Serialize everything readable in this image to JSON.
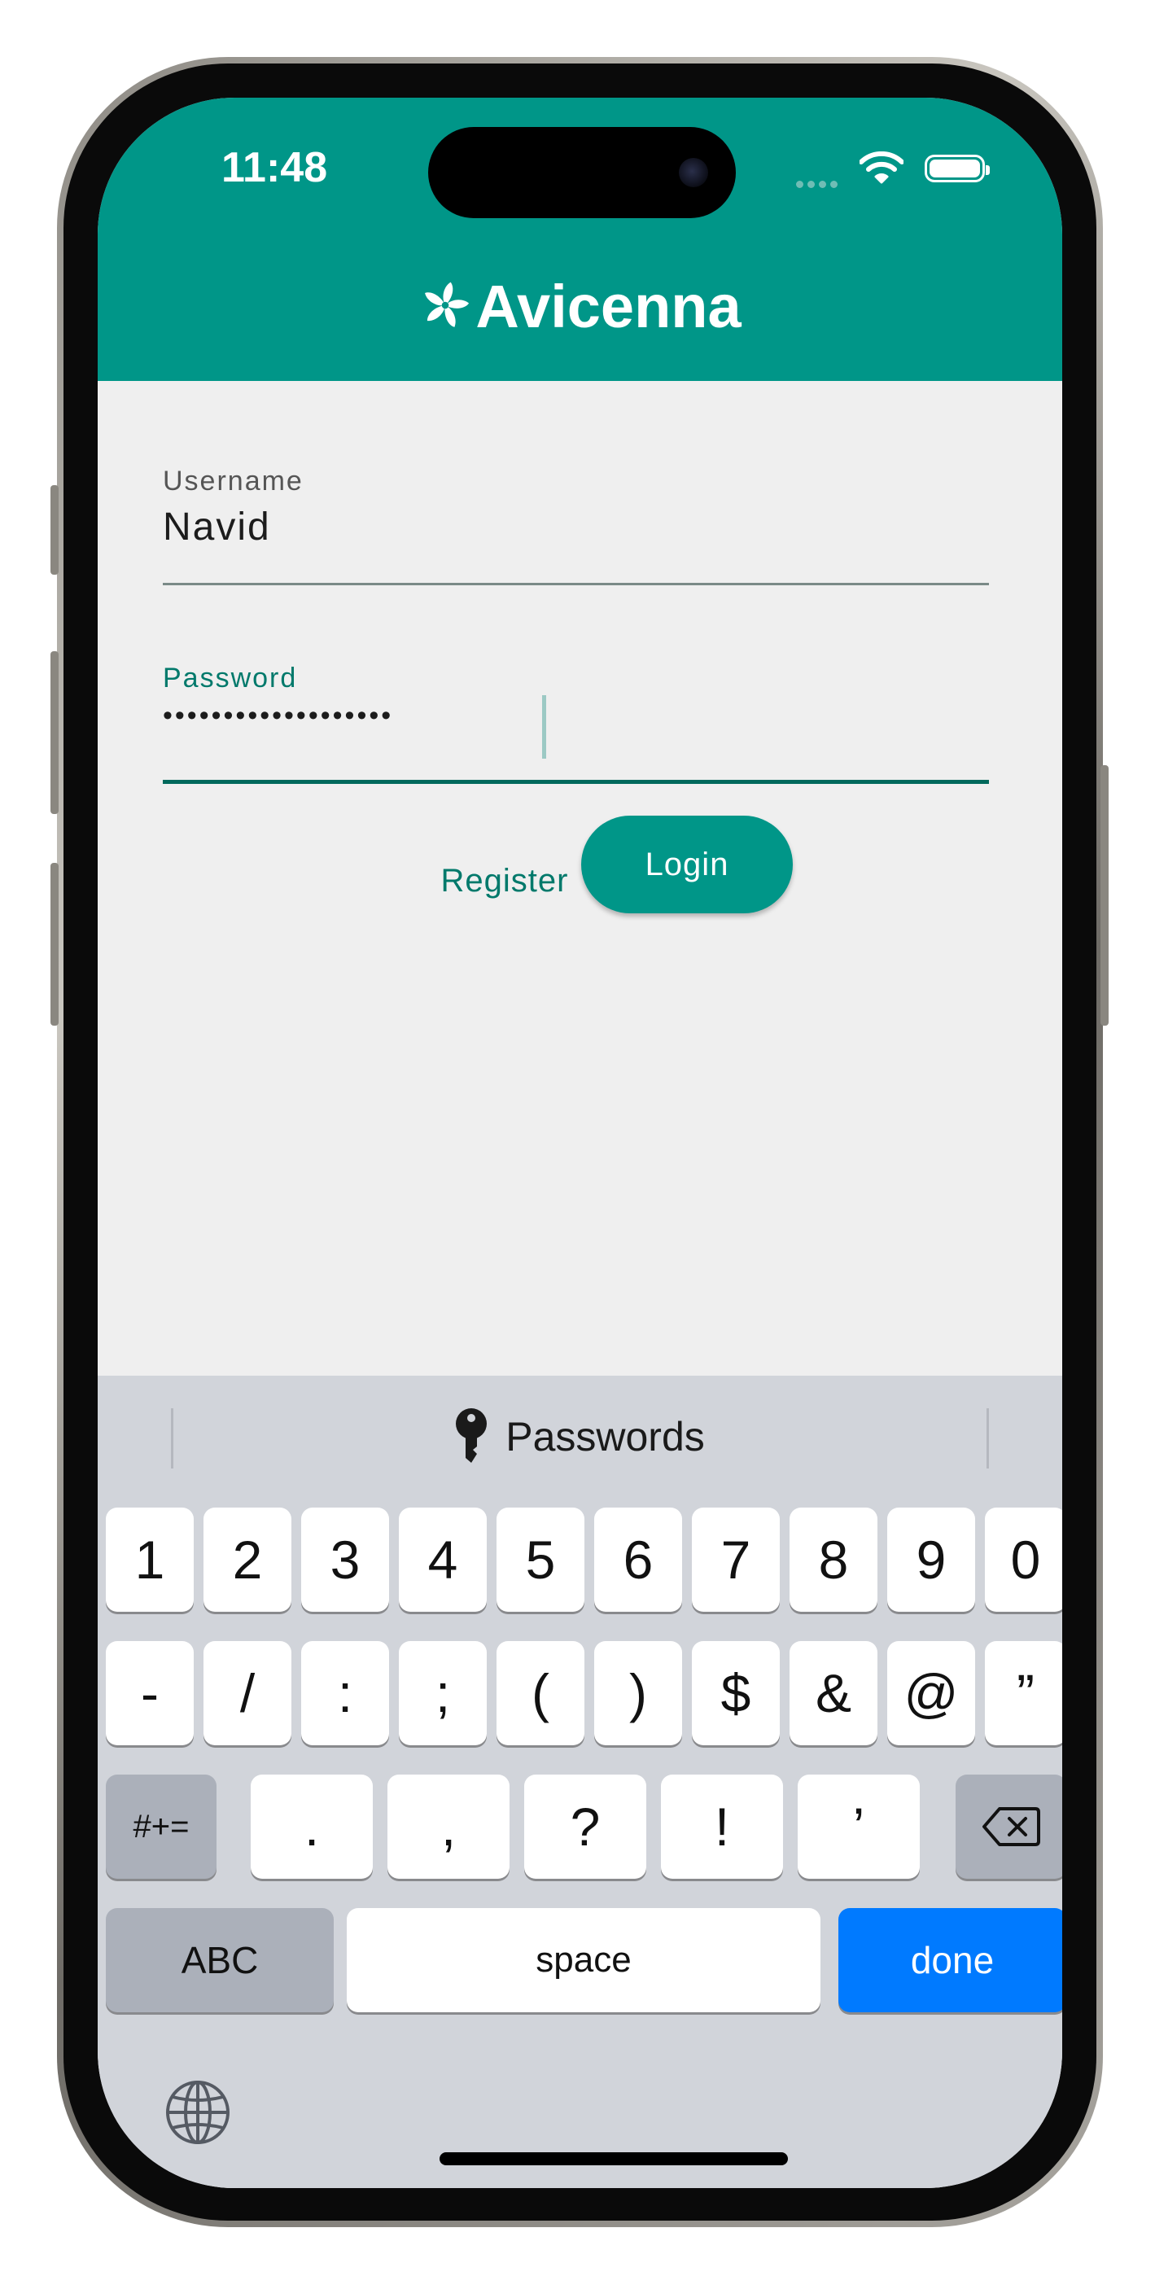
{
  "status_bar": {
    "time": "11:48"
  },
  "app_bar": {
    "title": "Avicenna",
    "logo_icon": "pinwheel-flower-icon",
    "background_color": "#009688"
  },
  "form": {
    "username": {
      "label": "Username",
      "value": "Navid"
    },
    "password": {
      "label": "Password",
      "value_masked": "•••••••••••••••••••"
    },
    "register_label": "Register",
    "login_label": "Login"
  },
  "keyboard": {
    "quicktype": {
      "icon": "key-icon",
      "label": "Passwords"
    },
    "row1": [
      "1",
      "2",
      "3",
      "4",
      "5",
      "6",
      "7",
      "8",
      "9",
      "0"
    ],
    "row2": [
      "-",
      "/",
      ":",
      ";",
      "(",
      ")",
      "$",
      "&",
      "@",
      "”"
    ],
    "row3": {
      "toggle_label": "#+=",
      "keys": [
        ".",
        ",",
        "?",
        "!",
        "’"
      ],
      "delete_icon": "backspace-icon"
    },
    "row4": {
      "abc_label": "ABC",
      "space_label": "space",
      "done_label": "done"
    },
    "globe_icon": "globe-icon",
    "accent_color": "#007aff"
  }
}
